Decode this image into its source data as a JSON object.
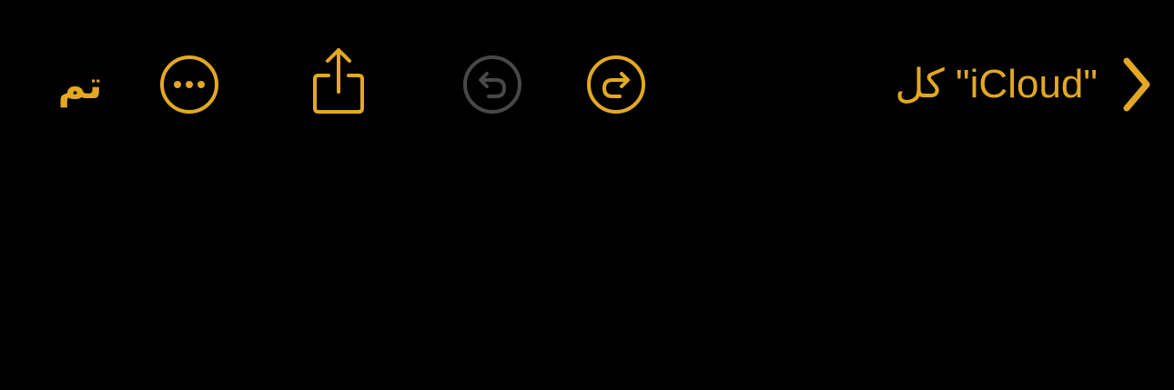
{
  "colors": {
    "background": "#000000",
    "accent": "#E3A822",
    "disabled": "#48484A"
  },
  "toolbar": {
    "done_label": "تم",
    "back_label": "كل \"iCloud\"",
    "icons": {
      "more": "ellipsis-circle-icon",
      "share": "share-icon",
      "undo": "undo-circle-icon",
      "redo": "redo-circle-icon",
      "back": "chevron-right-icon"
    },
    "undo_enabled": false,
    "redo_enabled": true
  }
}
